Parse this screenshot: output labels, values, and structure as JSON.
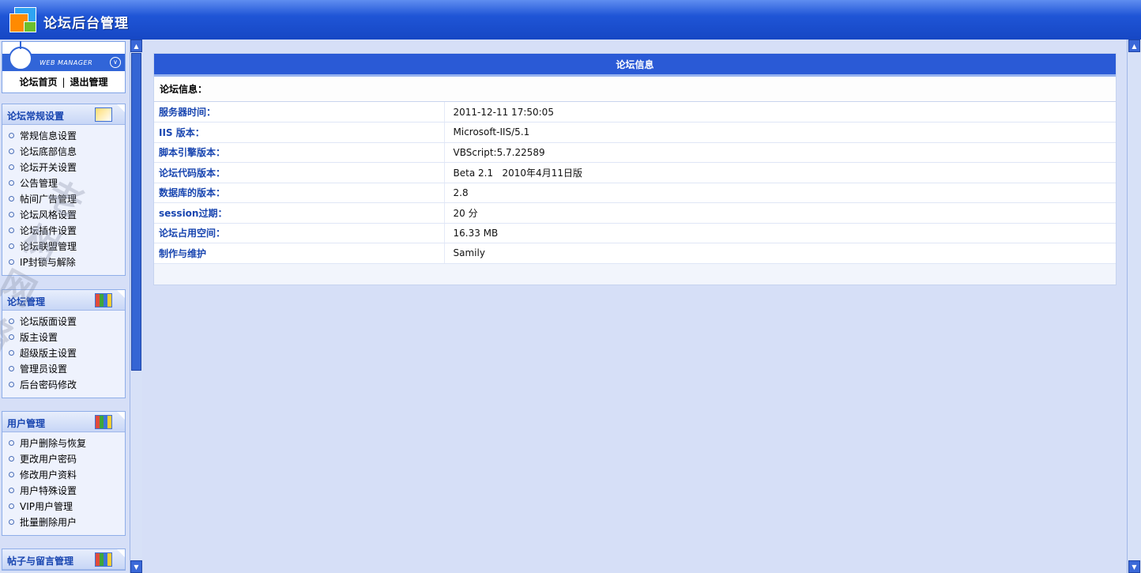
{
  "header": {
    "title": "论坛后台管理"
  },
  "manager": {
    "badge_text": "WEB MANAGER",
    "links": [
      "论坛首页",
      "退出管理"
    ],
    "separator": "|"
  },
  "sidebar": {
    "panels": [
      {
        "title": "论坛常规设置",
        "icon": "note-pencil-icon",
        "items": [
          "常规信息设置",
          "论坛底部信息",
          "论坛开关设置",
          "公告管理",
          "帖间广告管理",
          "论坛风格设置",
          "论坛插件设置",
          "论坛联盟管理",
          "IP封锁与解除"
        ]
      },
      {
        "title": "论坛管理",
        "icon": "colored-book-icon",
        "items": [
          "论坛版面设置",
          "版主设置",
          "超级版主设置",
          "管理员设置",
          "后台密码修改"
        ]
      },
      {
        "title": "用户管理",
        "icon": "colored-book-icon",
        "items": [
          "用户删除与恢复",
          "更改用户密码",
          "修改用户资料",
          "用户特殊设置",
          "VIP用户管理",
          "批量删除用户"
        ]
      },
      {
        "title": "帖子与留言管理",
        "icon": "colored-book-icon",
        "items": []
      }
    ]
  },
  "main": {
    "heading": "论坛信息",
    "subheading": "论坛信息：",
    "rows": [
      {
        "label": "服务器时间：",
        "value": "2011-12-11 17:50:05"
      },
      {
        "label": "IIS 版本：",
        "value": "Microsoft-IIS/5.1"
      },
      {
        "label": "脚本引擎版本：",
        "value": "VBScript:5.7.22589"
      },
      {
        "label": "论坛代码版本：",
        "value": "Beta 2.1   2010年4月11日版"
      },
      {
        "label": "数据库的版本：",
        "value": "2.8"
      },
      {
        "label": "session过期：",
        "value": "20 分"
      },
      {
        "label": "论坛占用空间：",
        "value": "16.33 MB"
      },
      {
        "label": "制作与维护",
        "value": "Samily"
      }
    ]
  },
  "watermark": "老树网络",
  "colors": {
    "header_blue": "#1f55d6",
    "label_blue": "#1845b0",
    "page_bg": "#d6dff7"
  }
}
